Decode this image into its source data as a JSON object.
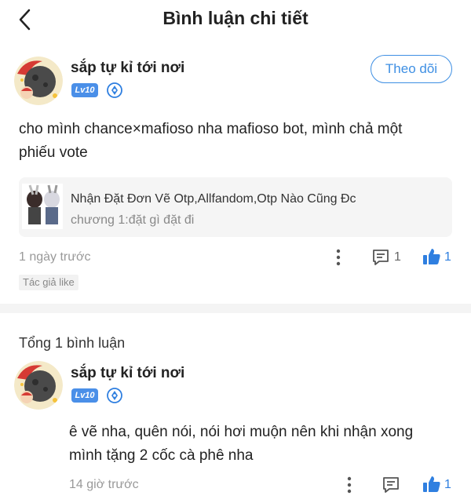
{
  "header": {
    "title": "Bình luận chi tiết"
  },
  "post": {
    "username": "sắp tự kỉ tới nơi",
    "level": "Lv10",
    "follow_label": "Theo dõi",
    "text_line1": "cho mình chance×mafioso nha mafioso bot, mình chả một",
    "text_line2": "phiếu vote",
    "book": {
      "title": "Nhận Đặt Đơn Vẽ Otp,Allfandom,Otp Nào Cũng Đc",
      "chapter": "chương 1:đặt gì đặt đi"
    },
    "time": "1 ngày trước",
    "comment_count": "1",
    "like_count": "1",
    "author_tag": "Tác giả like"
  },
  "comments_section": {
    "total_label": "Tổng 1 bình luận"
  },
  "reply": {
    "username": "sắp tự kỉ tới nơi",
    "level": "Lv10",
    "text_line1": "ê vẽ nha, quên nói, nói hơi muộn nên khi nhận xong",
    "text_line2": "mình tặng 2 cốc cà phê nha",
    "time": "14 giờ trước",
    "like_count": "1"
  },
  "colors": {
    "accent": "#3e8fe3",
    "level_badge": "#4a8fe8",
    "meta_text": "#999999"
  },
  "icons": [
    "back-arrow-icon",
    "verified-badge-icon",
    "more-vertical-icon",
    "comment-icon",
    "thumbs-up-icon"
  ]
}
